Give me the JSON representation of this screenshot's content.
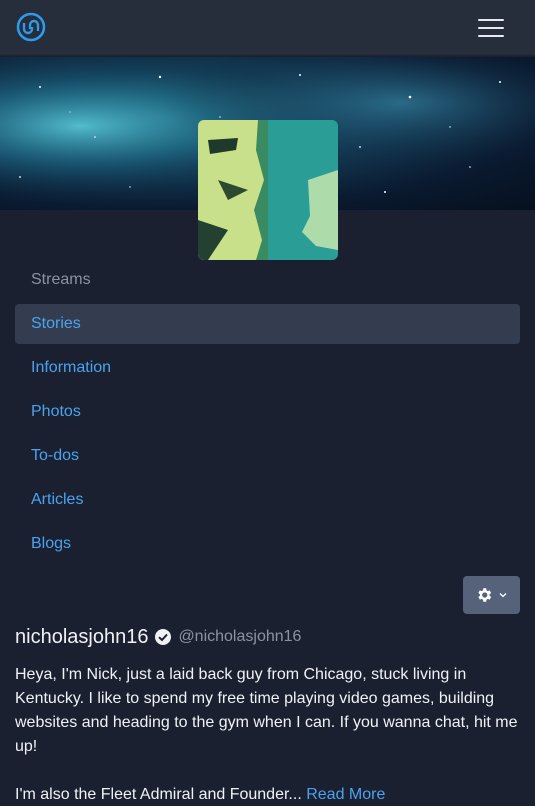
{
  "navbar": {
    "logo_icon": "unstoppable-logo-icon",
    "menu_icon": "hamburger-menu-icon",
    "accent": "#2e9ae8"
  },
  "banner": {
    "image": "space-nebula-banner"
  },
  "avatar": {
    "image": "profile-avatar"
  },
  "nav": {
    "items": [
      {
        "label": "Streams",
        "state": "muted"
      },
      {
        "label": "Stories",
        "state": "active"
      },
      {
        "label": "Information",
        "state": "link"
      },
      {
        "label": "Photos",
        "state": "link"
      },
      {
        "label": "To-dos",
        "state": "link"
      },
      {
        "label": "Articles",
        "state": "link"
      },
      {
        "label": "Blogs",
        "state": "link"
      }
    ]
  },
  "settings": {
    "icon": "gear-icon",
    "caret_icon": "chevron-down-icon"
  },
  "profile": {
    "name": "nicholasjohn16",
    "verified_icon": "verified-check-icon",
    "handle": "@nicholasjohn16",
    "bio": "Heya, I'm Nick, just a laid back guy from Chicago, stuck living in Kentucky. I like to spend my free time playing video games, building websites and heading to the gym when I can. If you wanna chat, hit me up!",
    "bio_more": "I'm also the Fleet Admiral and Founder...",
    "read_more": "Read More"
  },
  "colors": {
    "background": "#1a2030",
    "navbar": "#262d3b",
    "link": "#4aa3ee",
    "active_item": "#343d4f",
    "settings_button": "#55627a"
  }
}
